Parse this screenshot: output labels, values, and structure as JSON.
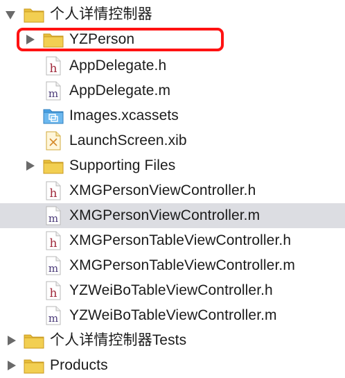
{
  "navigator": {
    "items": [
      {
        "label": "个人详情控制器",
        "kind": "folder",
        "disclosure": "expanded"
      },
      {
        "label": "YZPerson",
        "kind": "folder",
        "disclosure": "collapsed",
        "highlighted": true
      },
      {
        "label": "AppDelegate.h",
        "kind": "header-file",
        "icon_letter": "h"
      },
      {
        "label": "AppDelegate.m",
        "kind": "implementation-file",
        "icon_letter": "m"
      },
      {
        "label": "Images.xcassets",
        "kind": "asset-catalog"
      },
      {
        "label": "LaunchScreen.xib",
        "kind": "xib-file"
      },
      {
        "label": "Supporting Files",
        "kind": "folder",
        "disclosure": "collapsed"
      },
      {
        "label": "XMGPersonViewController.h",
        "kind": "header-file",
        "icon_letter": "h"
      },
      {
        "label": "XMGPersonViewController.m",
        "kind": "implementation-file",
        "icon_letter": "m",
        "selected": true
      },
      {
        "label": "XMGPersonTableViewController.h",
        "kind": "header-file",
        "icon_letter": "h"
      },
      {
        "label": "XMGPersonTableViewController.m",
        "kind": "implementation-file",
        "icon_letter": "m"
      },
      {
        "label": "YZWeiBoTableViewController.h",
        "kind": "header-file",
        "icon_letter": "h"
      },
      {
        "label": "YZWeiBoTableViewController.m",
        "kind": "implementation-file",
        "icon_letter": "m"
      },
      {
        "label": "个人详情控制器Tests",
        "kind": "folder",
        "disclosure": "collapsed"
      },
      {
        "label": "Products",
        "kind": "folder",
        "disclosure": "collapsed"
      }
    ]
  },
  "colors": {
    "selection": "#dcdde2",
    "highlight_border": "#ff1212",
    "folder": "#e8bf3c",
    "header_letter": "#a0283a",
    "impl_letter": "#4a3a78",
    "asset_blue": "#4aa3e6"
  }
}
